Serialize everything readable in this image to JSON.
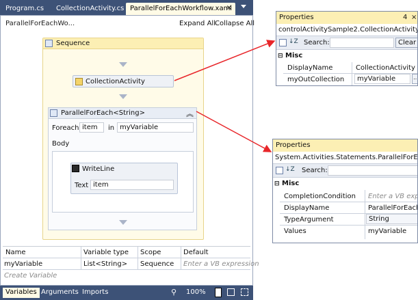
{
  "tabs": [
    {
      "label": "Program.cs"
    },
    {
      "label": "CollectionActivity.cs"
    },
    {
      "label": "ParallelForEachWorkflow.xaml",
      "active": true
    }
  ],
  "tab_close_glyph": "×",
  "designer": {
    "breadcrumb": "ParallelForEachWo...",
    "expand_all": "Expand All",
    "collapse_all": "Collapse All",
    "sequence_label": "Sequence",
    "collection_activity_label": "CollectionActivity",
    "parallel_label": "ParallelForEach<String>",
    "foreach_label": "Foreach",
    "foreach_var": "item",
    "in_label": "in",
    "in_value": "myVariable",
    "body_label": "Body",
    "writeline_label": "WriteLine",
    "text_label": "Text",
    "text_value": "item"
  },
  "variables_grid": {
    "headers": [
      "Name",
      "Variable type",
      "Scope",
      "Default"
    ],
    "row": {
      "name": "myVariable",
      "type": "List<String>",
      "scope": "Sequence",
      "default": "Enter a VB expression"
    },
    "create_label": "Create Variable"
  },
  "bottom": {
    "tabs": [
      "Variables",
      "Arguments",
      "Imports"
    ],
    "zoom": "100%"
  },
  "props1": {
    "title": "Properties",
    "pin_glyph": "4",
    "close_glyph": "×",
    "object": "controlActivitySample2.CollectionActivity",
    "search_label": "Search:",
    "clear_label": "Clear",
    "category": "Misc",
    "rows": [
      {
        "name": "DisplayName",
        "value": "CollectionActivity"
      },
      {
        "name": "myOutCollection",
        "value": "myVariable"
      }
    ],
    "ellipsis": "..."
  },
  "props2": {
    "title": "Properties",
    "object": "System.Activities.Statements.ParallelForEach<Sys",
    "search_label": "Search:",
    "category": "Misc",
    "rows": [
      {
        "name": "CompletionCondition",
        "value": "Enter a VB expressi",
        "placeholder": true
      },
      {
        "name": "DisplayName",
        "value": "ParallelForEach<S"
      },
      {
        "name": "TypeArgument",
        "value": "String"
      },
      {
        "name": "Values",
        "value": "myVariable"
      }
    ]
  },
  "colors": {
    "arrow": "#e8262a",
    "tabbar": "#3d5277",
    "sequence_header": "#fcefb4"
  }
}
